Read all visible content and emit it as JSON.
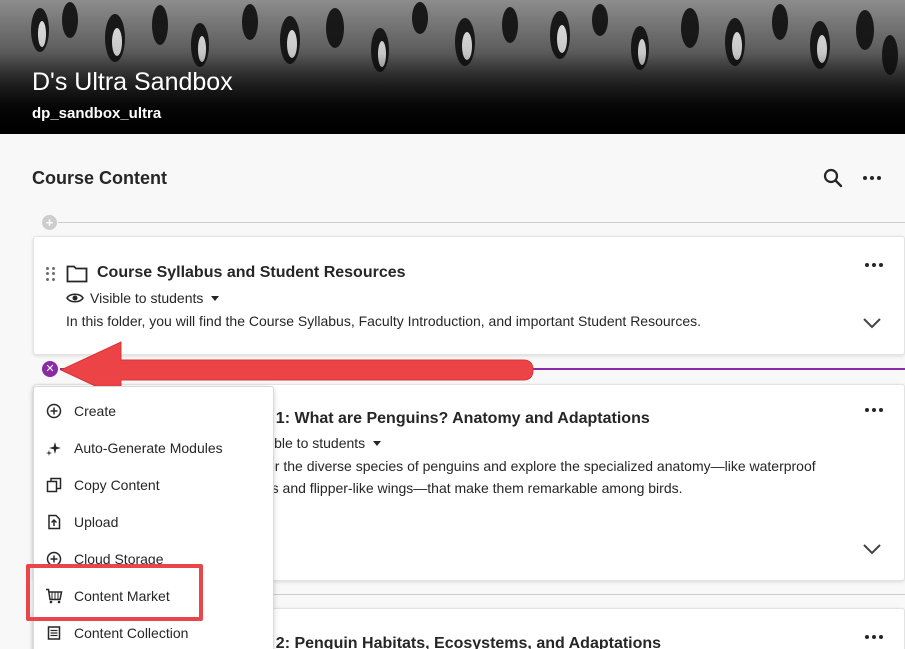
{
  "banner": {
    "course_title": "D's Ultra Sandbox",
    "course_id": "dp_sandbox_ultra"
  },
  "header": {
    "section_title": "Course Content",
    "search_icon": "search-icon",
    "more_icon": "more-horizontal-icon"
  },
  "cards": [
    {
      "title": "Course Syllabus and Student Resources",
      "visibility": "Visible to students",
      "description": "In this folder, you will find the Course Syllabus, Faculty Introduction, and important Student Resources.",
      "icon": "folder-icon"
    },
    {
      "title_fragment": "le 1: What are Penguins? Anatomy and Adaptations",
      "visibility_fragment": "ible to students",
      "description_line1": "er the diverse species of penguins and explore the specialized anatomy—like waterproof",
      "description_line2": "rs and flipper-like wings—that make them remarkable among birds."
    },
    {
      "title_fragment": "le 2: Penguin Habitats, Ecosystems, and Adaptations"
    }
  ],
  "menu": {
    "items": [
      {
        "label": "Create",
        "icon": "plus-circle-icon"
      },
      {
        "label": "Auto-Generate Modules",
        "icon": "sparkle-icon"
      },
      {
        "label": "Copy Content",
        "icon": "copy-icon"
      },
      {
        "label": "Upload",
        "icon": "upload-icon"
      },
      {
        "label": "Cloud Storage",
        "icon": "cloud-storage-icon"
      },
      {
        "label": "Content Market",
        "icon": "cart-icon"
      },
      {
        "label": "Content Collection",
        "icon": "collection-icon"
      }
    ]
  },
  "colors": {
    "accent_purple": "#8a2aa6",
    "highlight_red": "#e8464b",
    "text": "#262626"
  }
}
